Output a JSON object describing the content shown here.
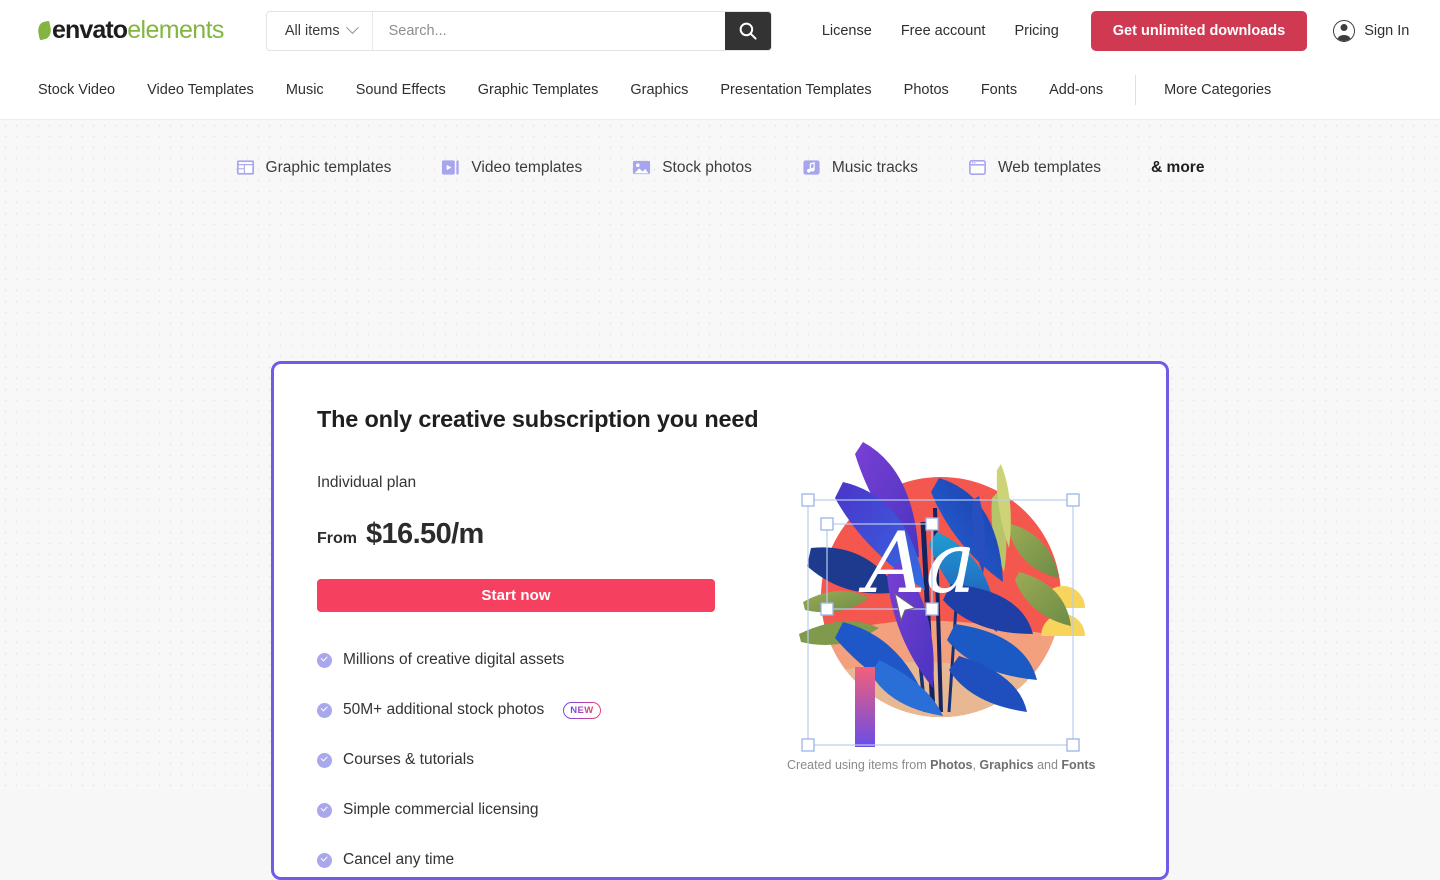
{
  "header": {
    "logo": {
      "brand": "envato",
      "suffix": "elements",
      "leaf_icon": "leaf-icon"
    },
    "search": {
      "scope_label": "All items",
      "placeholder": "Search...",
      "value": "",
      "search_icon": "search-icon",
      "chevron_icon": "chevron-down-icon"
    },
    "links": [
      "License",
      "Free account",
      "Pricing"
    ],
    "cta_label": "Get unlimited downloads",
    "signin_label": "Sign In",
    "avatar_icon": "user-avatar-icon",
    "colors": {
      "cta_bg": "#cf3a52",
      "search_btn_bg": "#333333"
    }
  },
  "nav": {
    "items": [
      "Stock Video",
      "Video Templates",
      "Music",
      "Sound Effects",
      "Graphic Templates",
      "Graphics",
      "Presentation Templates",
      "Photos",
      "Fonts",
      "Add-ons"
    ],
    "more": "More Categories"
  },
  "categories": {
    "items": [
      {
        "label": "Graphic templates",
        "icon": "layout-grid-icon"
      },
      {
        "label": "Video templates",
        "icon": "video-play-icon"
      },
      {
        "label": "Stock photos",
        "icon": "image-icon"
      },
      {
        "label": "Music tracks",
        "icon": "music-note-icon"
      },
      {
        "label": "Web templates",
        "icon": "browser-window-icon"
      }
    ],
    "more_label": "& more",
    "icon_color": "#a6a5ee"
  },
  "card": {
    "border_color": "#6c5ce7",
    "title": "The only creative subscription you need",
    "plan": "Individual plan",
    "price_prefix": "From",
    "price": "$16.50/m",
    "cta_label": "Start now",
    "cta_color": "#f5415f",
    "features": [
      {
        "text": "Millions of creative digital assets",
        "badge": null
      },
      {
        "text": "50M+ additional stock photos",
        "badge": "NEW"
      },
      {
        "text": "Courses & tutorials",
        "badge": null
      },
      {
        "text": "Simple commercial licensing",
        "badge": null
      },
      {
        "text": "Cancel any time",
        "badge": null
      }
    ],
    "illustration": {
      "name": "tropical-leaves-artwork",
      "overlay_text": "Aa",
      "selection_handles": 8,
      "handle_color": "#9ab4e8"
    },
    "credit": {
      "prefix": "Created using items from ",
      "item1": "Photos",
      "sep1": ", ",
      "item2": "Graphics",
      "sep2": " and ",
      "item3": "Fonts"
    }
  }
}
